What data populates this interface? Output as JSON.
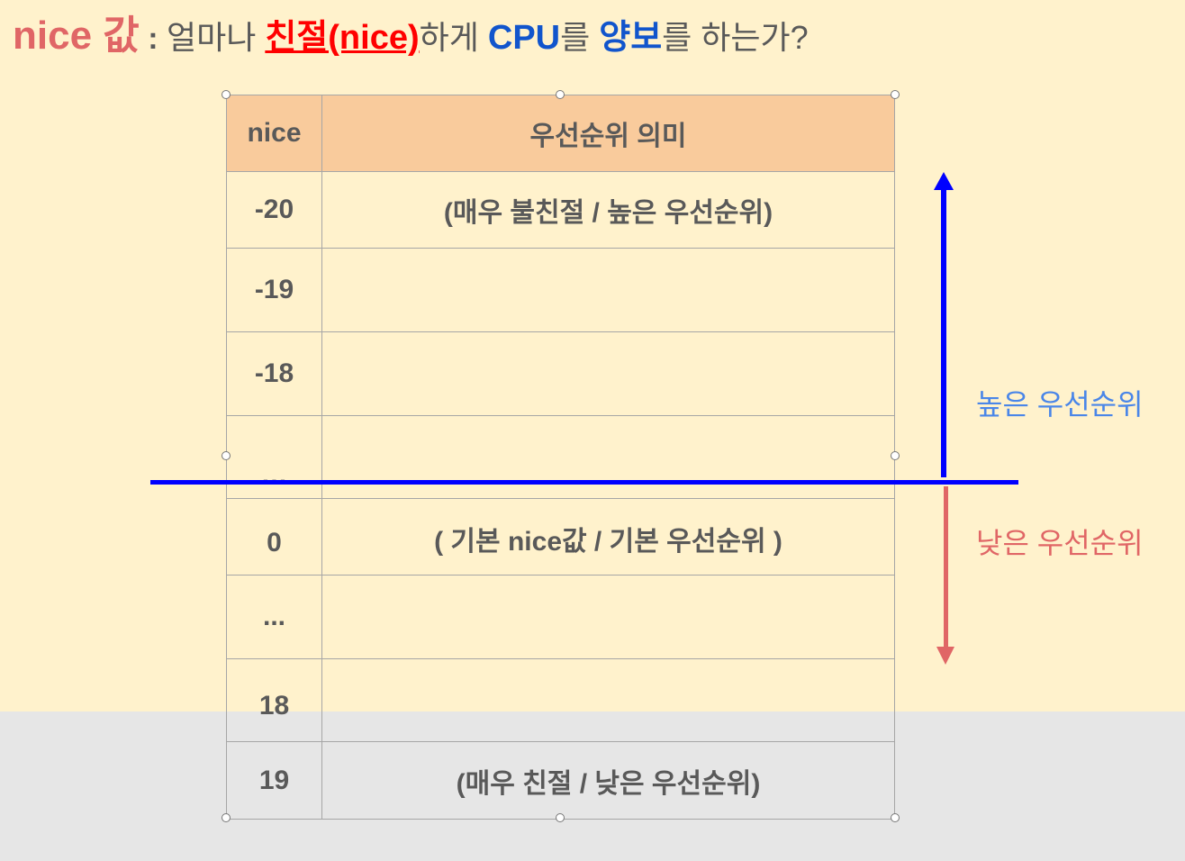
{
  "title": {
    "part1": "nice 값",
    "part2": " : ",
    "part3": "얼마나 ",
    "part4": "친절(nice)",
    "part5": "하게 ",
    "part6": "CPU",
    "part7": "를 ",
    "part8": "양보",
    "part9": "를 하는가?"
  },
  "table": {
    "header": {
      "nice": "nice",
      "meaning": "우선순위 의미"
    },
    "rows": [
      {
        "nice": "-20",
        "meaning": "(매우 불친절 / 높은 우선순위)"
      },
      {
        "nice": "-19",
        "meaning": ""
      },
      {
        "nice": "-18",
        "meaning": ""
      },
      {
        "nice": "…",
        "meaning": ""
      },
      {
        "nice": "0",
        "meaning": "( 기본 nice값 /  기본 우선순위 )"
      },
      {
        "nice": "...",
        "meaning": ""
      },
      {
        "nice": "18",
        "meaning": ""
      },
      {
        "nice": "19",
        "meaning": "(매우 친절 / 낮은 우선순위)"
      }
    ]
  },
  "labels": {
    "high": "높은 우선순위",
    "low": "낮은 우선순위"
  },
  "colors": {
    "background": "#fff2cc",
    "header_bg": "#f9cb9c",
    "high_blue": "#0000ff",
    "low_red": "#ff0000",
    "nice_title": "#e06666",
    "label_high": "#4a86e8",
    "label_low": "#e06666"
  },
  "icons": [
    "arrow-up-icon",
    "arrow-down-icon"
  ]
}
